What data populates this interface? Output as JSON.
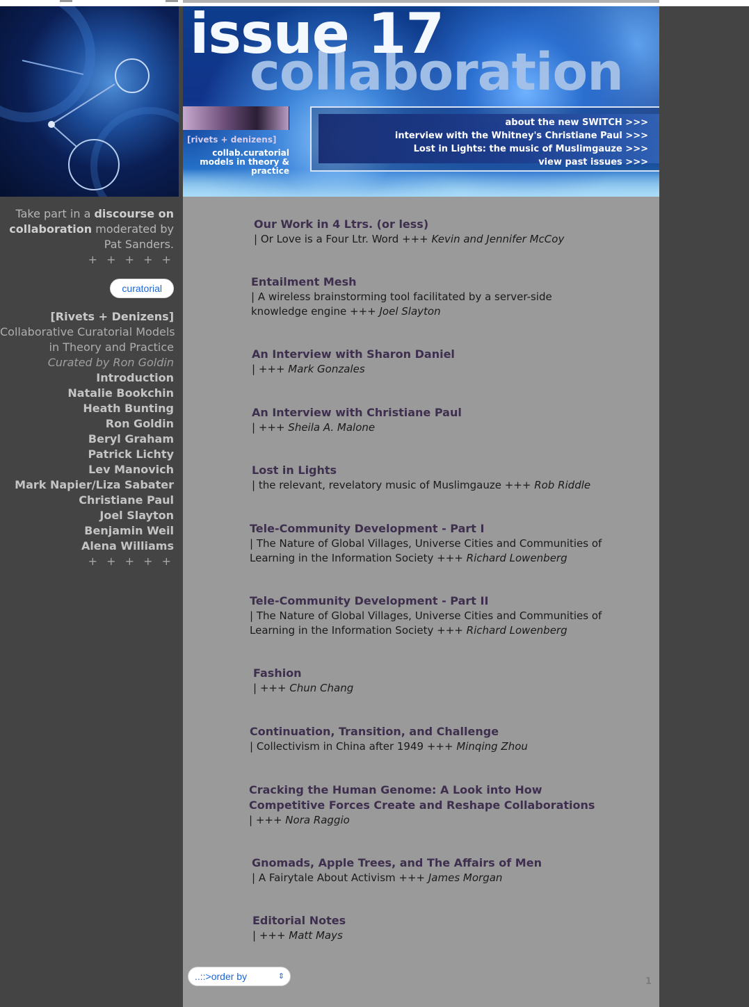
{
  "banner": {
    "issue": "issue 17",
    "theme": "collaboration",
    "caption_tag": "[rivets + denizens]",
    "caption_lines": [
      "collab.curatorial",
      "models in theory &",
      "practice"
    ],
    "links": [
      "about the new SWITCH >>>",
      "interview with the Whitney's Christiane Paul >>>",
      "Lost in Lights: the music of Muslimgauze >>>",
      "view past issues >>>"
    ]
  },
  "sidebar": {
    "intro_pre": "Take part in a ",
    "intro_bold": "discourse on collaboration",
    "intro_post": " moderated by Pat Sanders.",
    "plus_row": "+ + + + +",
    "pill": "curatorial",
    "section_title": "[Rivets + Denizens]",
    "section_sub_1": "Collaborative Curatorial Models",
    "section_sub_2": "in Theory and Practice",
    "curated_by": "Curated by Ron Goldin",
    "links": [
      "Introduction",
      "Natalie Bookchin",
      "Heath Bunting",
      "Ron Goldin",
      "Beryl Graham",
      "Patrick Lichty",
      "Lev Manovich",
      "Mark Napier/Liza Sabater",
      "Christiane Paul",
      "Joel Slayton",
      "Benjamin Weil",
      "Alena Williams"
    ],
    "plus_row_2": "+ + + + +"
  },
  "articles": [
    {
      "title": "Our Work in 4 Ltrs. (or less)",
      "desc": "| Or Love is a Four Ltr. Word +++ ",
      "author": "Kevin and Jennifer McCoy"
    },
    {
      "title": "Entailment Mesh",
      "desc": "| A wireless brainstorming tool facilitated by a server-side knowledge engine +++ ",
      "author": "Joel Slayton"
    },
    {
      "title": "An Interview with Sharon Daniel",
      "desc": "| +++ ",
      "author": "Mark Gonzales"
    },
    {
      "title": "An Interview with Christiane Paul",
      "desc": "| +++ ",
      "author": "Sheila A. Malone"
    },
    {
      "title": "Lost in Lights",
      "desc": "| the relevant, revelatory music of Muslimgauze +++ ",
      "author": "Rob Riddle"
    },
    {
      "title": "Tele-Community Development - Part I",
      "desc": "| The Nature of Global Villages, Universe Cities and Communities of Learning in the Information Society +++ ",
      "author": "Richard Lowenberg"
    },
    {
      "title": "Tele-Community Development - Part II",
      "desc": "| The Nature of Global Villages, Universe Cities and Communities of Learning in the Information Society +++ ",
      "author": "Richard Lowenberg"
    },
    {
      "title": "Fashion",
      "desc": "| +++ ",
      "author": "Chun Chang"
    },
    {
      "title": "Continuation, Transition, and Challenge",
      "desc": "| Collectivism in China after 1949 +++ ",
      "author": "Minqing Zhou"
    },
    {
      "title": "Cracking the Human Genome: A Look into How Competitive Forces Create and Reshape Collaborations",
      "desc": "| +++ ",
      "author": "Nora Raggio"
    },
    {
      "title": "Gnomads, Apple Trees, and The Affairs of Men",
      "desc": "| A Fairytale About Activism +++ ",
      "author": "James Morgan"
    },
    {
      "title": "Editorial Notes",
      "desc": "| +++ ",
      "author": "Matt Mays"
    }
  ],
  "footer": {
    "order_by": "..::>order by",
    "page_number": "1"
  },
  "icons": {
    "select_chevron": "up-down-chevron-icon"
  }
}
